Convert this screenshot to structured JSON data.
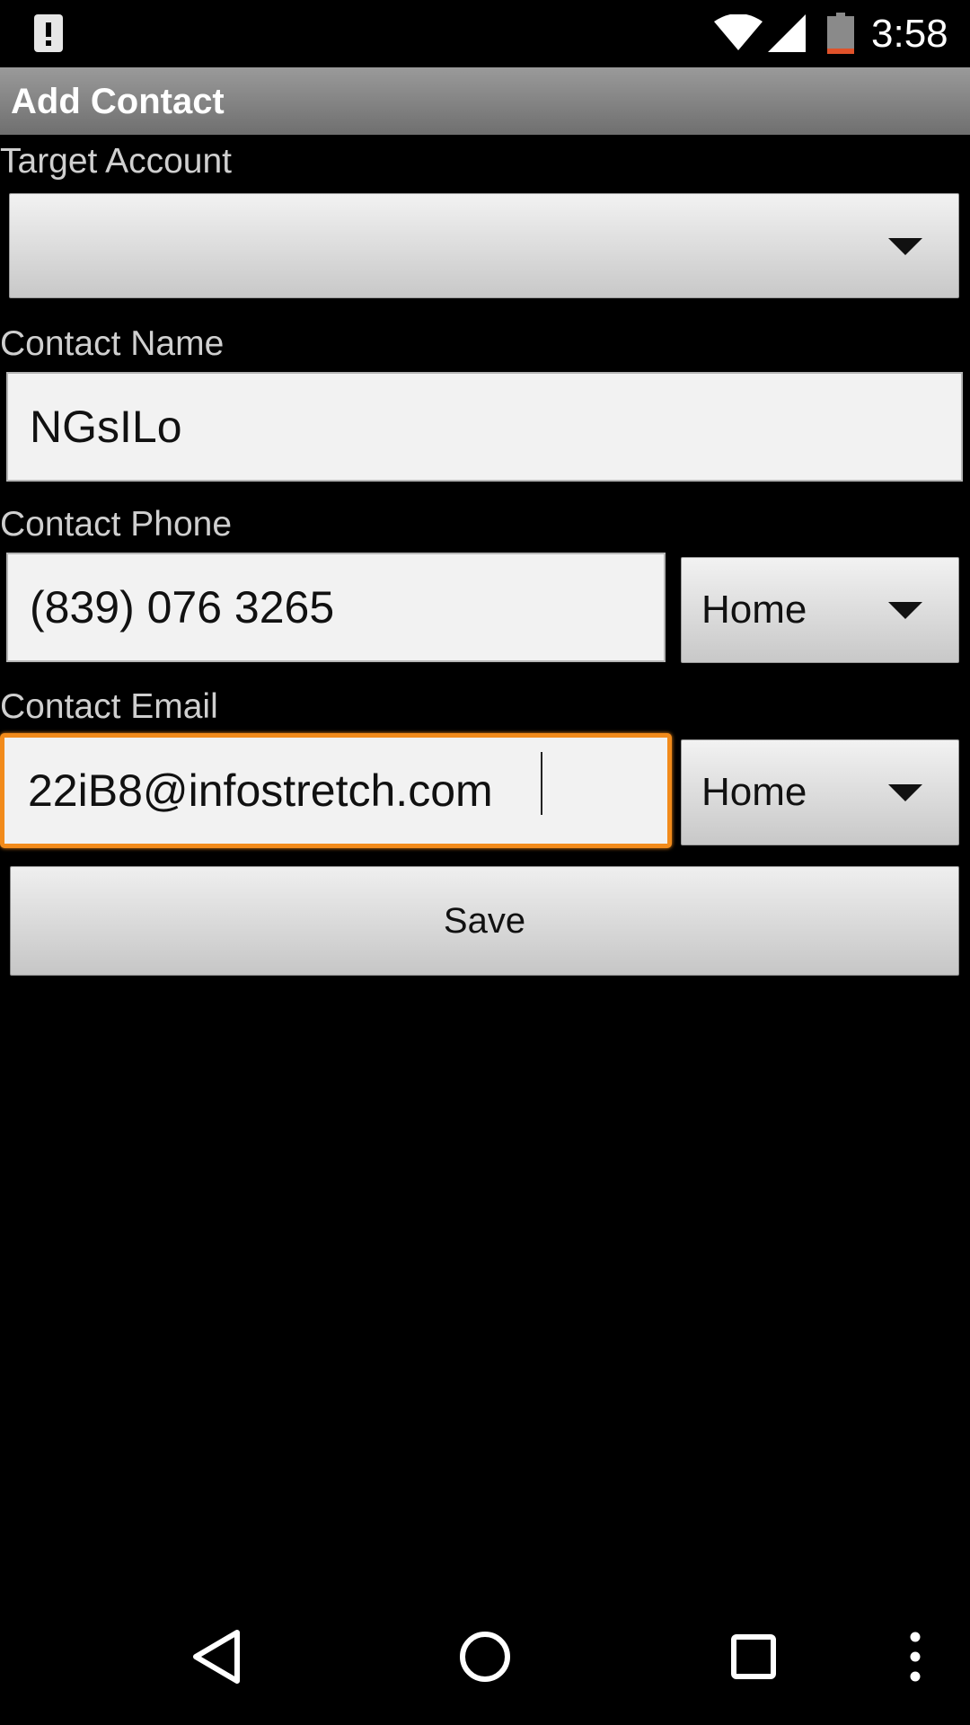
{
  "status_bar": {
    "time": "3:58",
    "icons": [
      "notification-alert-icon",
      "wifi-icon",
      "signal-icon",
      "battery-icon"
    ],
    "battery_color": "#e0522a"
  },
  "title_bar": {
    "title": "Add Contact"
  },
  "form": {
    "target_account": {
      "label": "Target Account",
      "selected": ""
    },
    "contact_name": {
      "label": "Contact Name",
      "value": "NGsILo"
    },
    "contact_phone": {
      "label": "Contact Phone",
      "value": "(839) 076 3265",
      "type": "Home"
    },
    "contact_email": {
      "label": "Contact Email",
      "value": "22iB8@infostretch.com",
      "type": "Home"
    },
    "save_label": "Save"
  },
  "nav_bar": {
    "icons": [
      "back-icon",
      "home-icon",
      "recents-icon",
      "overflow-menu-icon"
    ]
  },
  "colors": {
    "focus_accent": "#f28b1b",
    "title_bar": "#8a8a8a",
    "background": "#000000"
  }
}
